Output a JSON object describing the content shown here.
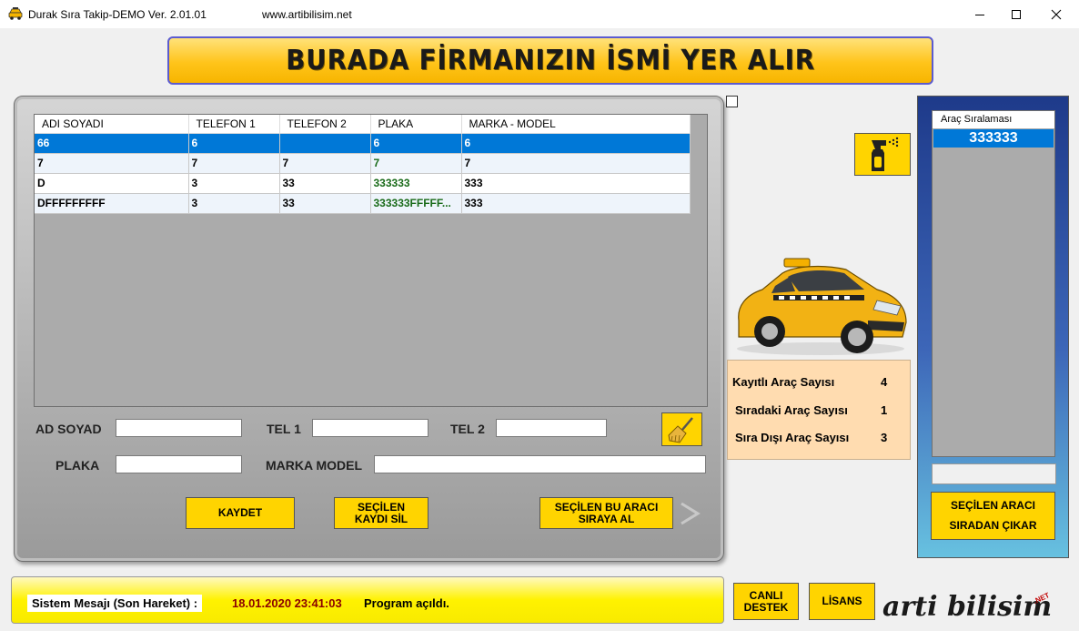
{
  "window": {
    "title": "Durak Sıra Takip-DEMO Ver.  2.01.01",
    "url": "www.artibilisim.net"
  },
  "banner": {
    "text": "BURADA FİRMANIZIN İSMİ YER ALIR"
  },
  "grid": {
    "columns": [
      "ADI SOYADI",
      "TELEFON 1",
      "TELEFON 2",
      "PLAKA",
      "MARKA - MODEL"
    ],
    "rows": [
      [
        "66",
        "6",
        "",
        "6",
        "6"
      ],
      [
        "7",
        "7",
        "7",
        "7",
        "7"
      ],
      [
        "D",
        "3",
        "33",
        "333333",
        "333"
      ],
      [
        "DFFFFFFFFF",
        "3",
        "33",
        "333333FFFFF...",
        "333"
      ]
    ],
    "selected_row": 0
  },
  "form": {
    "ad_soyad_label": "AD SOYAD",
    "tel1_label": "TEL 1",
    "tel2_label": "TEL 2",
    "plaka_label": "PLAKA",
    "marka_model_label": "MARKA MODEL",
    "ad_soyad_value": "",
    "tel1_value": "",
    "tel2_value": "",
    "plaka_value": "",
    "marka_model_value": ""
  },
  "buttons": {
    "kaydet": "KAYDET",
    "kaydi_sil": "SEÇİLEN\nKAYDI SİL",
    "siraya_al": "SEÇİLEN BU ARACI\nSIRAYA AL",
    "siradan_cikar": "SEÇİLEN ARACI\n\nSIRADAN ÇIKAR",
    "canli_destek": "CANLI\nDESTEK",
    "lisans": "LİSANS"
  },
  "stats": {
    "kayitli_label": "Kayıtlı Araç Sayısı",
    "kayitli_value": "4",
    "siradaki_label": "Sıradaki Araç Sayısı",
    "siradaki_value": "1",
    "sira_disi_label": "Sıra Dışı Araç Sayısı",
    "sira_disi_value": "3"
  },
  "queue": {
    "header": "Araç Sıralaması",
    "items": [
      "333333"
    ]
  },
  "status": {
    "label": "Sistem Mesajı (Son Hareket) :",
    "timestamp": "18.01.2020 23:41:03",
    "message": "Program açıldı."
  },
  "logo": {
    "text": "arti bilisim",
    "suffix": ".NET"
  },
  "icons": {
    "app": "taxi-icon",
    "spray": "spray-bottle-icon",
    "broom": "broom-icon",
    "chevron": "chevron-right-icon",
    "car": "taxi-car-image"
  },
  "colors": {
    "accent_yellow": "#ffd400",
    "selection_blue": "#0078d7",
    "stats_bg": "#ffdcb0",
    "status_date": "#8b0000"
  }
}
